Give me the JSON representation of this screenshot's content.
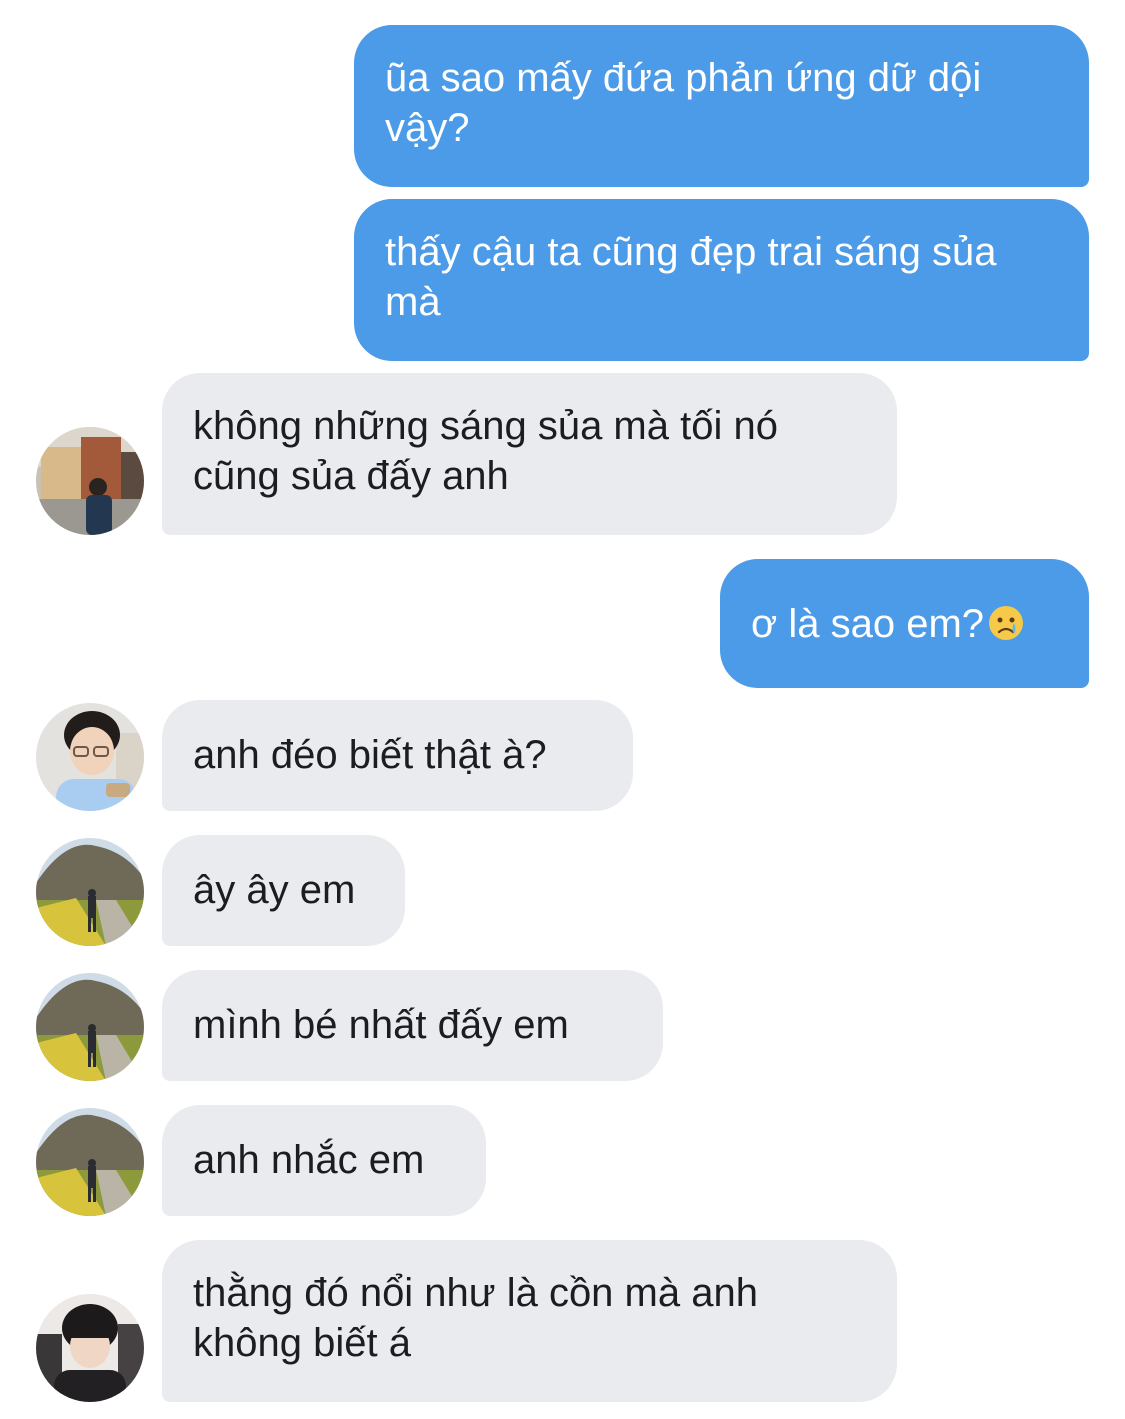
{
  "messages": [
    {
      "from": "me",
      "text": "ũa sao mấy đứa phản ứng dữ dội vậy?"
    },
    {
      "from": "me",
      "text": "thấy cậu ta cũng đẹp trai sáng sủa mà"
    },
    {
      "from": "them",
      "avatar": "avatar-street-photo",
      "text": "không những sáng sủa mà tối nó cũng sủa đấy anh"
    },
    {
      "from": "me",
      "text": "ơ là sao em?",
      "emoji": "crying-face-icon"
    },
    {
      "from": "them",
      "avatar": "avatar-glasses-boy",
      "text": "anh đéo biết thật à?"
    },
    {
      "from": "them",
      "avatar": "avatar-mountain-landscape",
      "text": "ây ây em"
    },
    {
      "from": "them",
      "avatar": "avatar-mountain-landscape",
      "text": "mình bé nhất đấy em"
    },
    {
      "from": "them",
      "avatar": "avatar-mountain-landscape",
      "text": "anh nhắc em"
    },
    {
      "from": "them",
      "avatar": "avatar-gamer-boy",
      "text": "thằng đó nổi như là cồn mà anh không biết á"
    }
  ],
  "colors": {
    "outgoing_bubble": "#4b9be8",
    "incoming_bubble": "#e9ebef",
    "outgoing_text": "#ffffff",
    "incoming_text": "#1c1d21"
  }
}
